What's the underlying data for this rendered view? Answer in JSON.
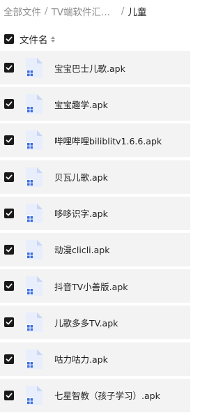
{
  "breadcrumb": {
    "root": "全部文件",
    "separator": "/",
    "folder": "TV端软件汇...",
    "current": "儿童"
  },
  "header": {
    "column_label": "文件名"
  },
  "files": [
    {
      "name": "宝宝巴士儿歌.apk",
      "checked": true
    },
    {
      "name": "宝宝趣学.apk",
      "checked": true
    },
    {
      "name": "哔哩哔哩biliblitv1.6.6.apk",
      "checked": true
    },
    {
      "name": "贝瓦儿歌.apk",
      "checked": true
    },
    {
      "name": "哆哆识字.apk",
      "checked": true
    },
    {
      "name": "动漫clicli.apk",
      "checked": true
    },
    {
      "name": "抖音TV小善版.apk",
      "checked": true
    },
    {
      "name": "儿歌多多TV.apk",
      "checked": true
    },
    {
      "name": "咕力咕力.apk",
      "checked": true
    },
    {
      "name": "七星智教（孩子学习）.apk",
      "checked": true
    }
  ],
  "icons": {
    "checkbox": "checkbox-checked-icon",
    "sort": "sort-icon",
    "file": "apk-file-icon"
  },
  "colors": {
    "row_background": "#f3f3f3",
    "checkbox": "#1a1a1a",
    "file_icon_accent": "#3f6fe0"
  }
}
